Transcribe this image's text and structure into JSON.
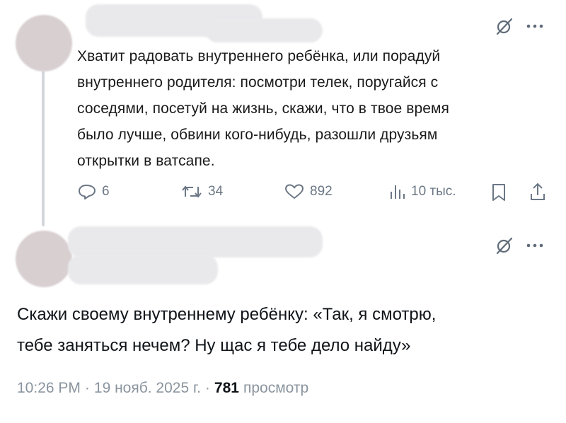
{
  "post1": {
    "text": "Хватит радовать внутреннего ребёнка, или порадуй\nвнутреннего родителя: посмотри телек, поругайся с\nсоседями, посетуй на жизнь, скажи, что в твое время\nбыло лучше, обвини кого-нибудь, разошли друзьям\nоткрытки в ватсапе.",
    "actions": {
      "replies": "6",
      "reposts": "34",
      "likes": "892",
      "views": "10 тыс."
    }
  },
  "post2": {
    "text": "Скажи своему внутреннему ребёнку: «Так, я смотрю,\nтебе заняться нечем? Ну щас я тебе дело найду»",
    "time": "10:26 PM",
    "separator": "·",
    "date": "19 нояб. 2025 г.",
    "separator2": "·",
    "views_count": "781",
    "views_label": "просмотр"
  },
  "icons": {
    "grok": "grok-slash-icon",
    "more": "more-dots-icon",
    "reply": "reply-icon",
    "repost": "repost-icon",
    "like": "heart-icon",
    "views": "views-bars-icon",
    "bookmark": "bookmark-icon",
    "share": "share-icon"
  },
  "colors": {
    "icon_gray": "#6b7785",
    "text": "#0f1419",
    "thread_line": "#d3d6da"
  }
}
